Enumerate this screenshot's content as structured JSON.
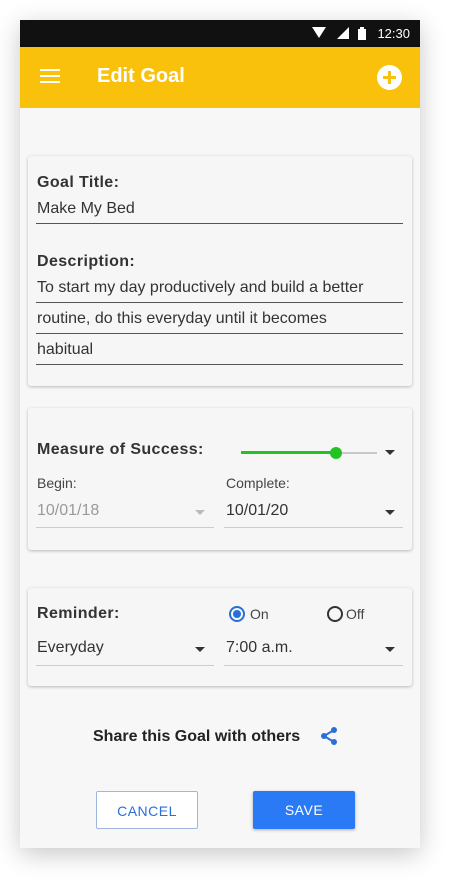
{
  "status_bar": {
    "time": "12:30"
  },
  "app_bar": {
    "title": "Edit Goal"
  },
  "goal": {
    "title_label": "Goal Title:",
    "title_value": "Make My Bed",
    "description_label": "Description:",
    "description_lines": [
      "To start my day productively and build a better",
      "routine, do this everyday until it becomes",
      "habitual"
    ]
  },
  "success": {
    "label": "Measure of Success:",
    "slider_level": 0.7,
    "begin_label": "Begin:",
    "begin_value": "10/01/18",
    "complete_label": "Complete:",
    "complete_value": "10/01/20"
  },
  "reminder": {
    "label": "Reminder:",
    "on_label": "On",
    "off_label": "Off",
    "selected": "On",
    "frequency": "Everyday",
    "time": "7:00 a.m."
  },
  "share": {
    "text": "Share this Goal with others"
  },
  "actions": {
    "cancel": "CANCEL",
    "save": "SAVE"
  },
  "colors": {
    "accent_yellow": "#f9c10b",
    "primary_blue": "#2a7af5",
    "slider_green": "#22c322"
  }
}
